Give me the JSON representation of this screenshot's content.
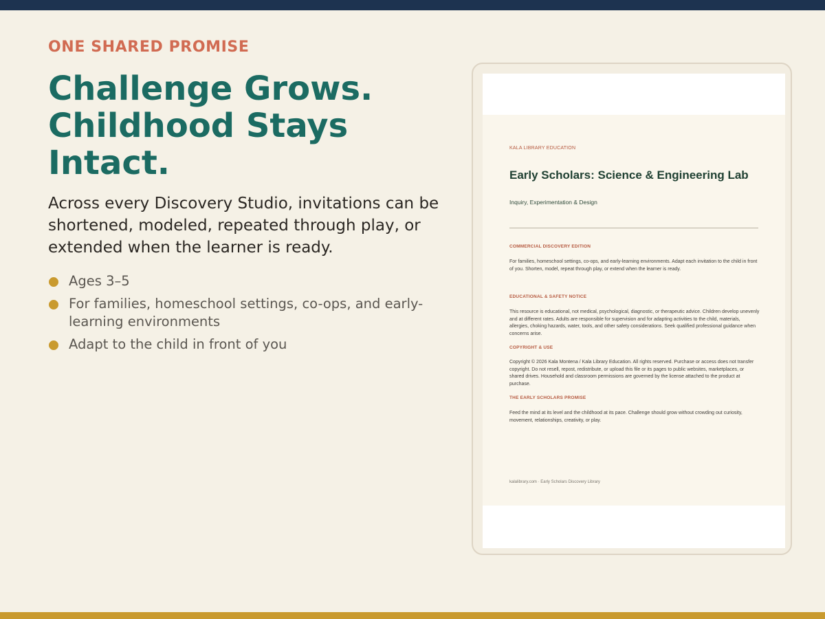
{
  "slide": {
    "eyebrow": "ONE SHARED PROMISE",
    "headline_lines": [
      "Challenge Grows.",
      "Childhood Stays",
      "Intact."
    ],
    "lede": "Across every Discovery Studio, invitations can be shortened, modeled, repeated through play, or extended when the learner is ready.",
    "bullets": [
      "Ages 3–5",
      "For families, homeschool settings, co-ops, and early-learning environments",
      "Adapt to the child in front of you"
    ]
  },
  "document": {
    "org": "KALA LIBRARY EDUCATION",
    "title": "Early Scholars: Science & Engineering Lab",
    "subtitle": "Inquiry, Experimentation & Design",
    "sections": [
      {
        "heading": "COMMERCIAL DISCOVERY EDITION",
        "body": "For families, homeschool settings, co-ops, and early-learning environments. Adapt each invitation to the child in front of you. Shorten, model, repeat through play, or extend when the learner is ready."
      },
      {
        "heading": "EDUCATIONAL & SAFETY NOTICE",
        "body": "This resource is educational, not medical, psychological, diagnostic, or therapeutic advice. Children develop unevenly and at different rates. Adults are responsible for supervision and for adapting activities to the child, materials, allergies, choking hazards, water, tools, and other safety considerations. Seek qualified professional guidance when concerns arise."
      },
      {
        "heading": "COPYRIGHT & USE",
        "body": "Copyright © 2026 Kala Montena / Kala Library Education. All rights reserved. Purchase or access does not transfer copyright. Do not resell, repost, redistribute, or upload this file or its pages to public websites, marketplaces, or shared drives. Household and classroom permissions are governed by the license attached to the product at purchase."
      },
      {
        "heading": "THE EARLY SCHOLARS PROMISE",
        "body": "Feed the mind at its level and the childhood at its pace. Challenge should grow without crowding out curiosity, movement, relationships, creativity, or play."
      }
    ],
    "footer": "kalalibrary.com  ·  Early Scholars Discovery Library"
  },
  "colors": {
    "navy": "#1d3350",
    "teal": "#1b6b62",
    "coral": "#d16b52",
    "gold": "#c99a2e",
    "cream": "#f5f1e6"
  }
}
